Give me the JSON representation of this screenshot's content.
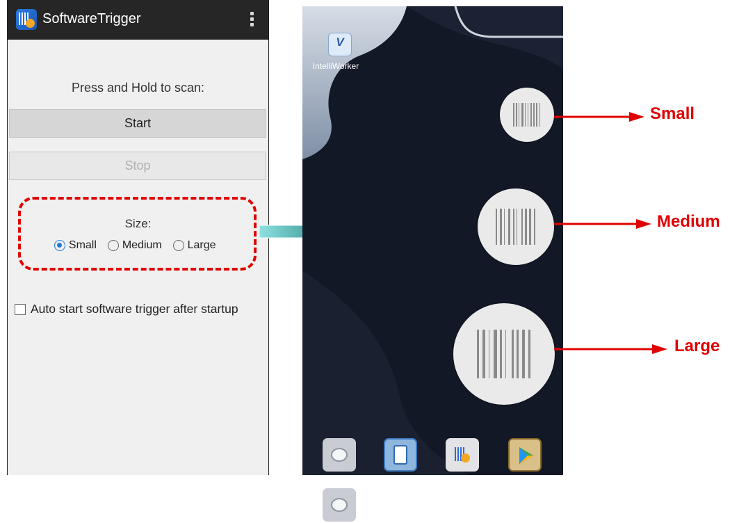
{
  "app": {
    "title": "SoftwareTrigger",
    "icon": "software-trigger-icon",
    "menu_icon": "overflow-menu-icon",
    "scan_prompt": "Press and Hold to scan:",
    "start_label": "Start",
    "stop_label": "Stop",
    "size_label": "Size:",
    "size_options": [
      {
        "label": "Small",
        "checked": true
      },
      {
        "label": "Medium",
        "checked": false
      },
      {
        "label": "Large",
        "checked": false
      }
    ],
    "auto_start_label": "Auto start software trigger after startup",
    "auto_start_checked": false
  },
  "home": {
    "app_label": "IntelliWorker",
    "app_icon": "intelliworker-icon",
    "floating_triggers": [
      "small",
      "medium",
      "large"
    ],
    "dock": [
      "keyboard-app-icon",
      "task-app-icon",
      "software-trigger-app-icon",
      "play-store-icon"
    ]
  },
  "annotations": {
    "small": "Small",
    "medium": "Medium",
    "large": "Large",
    "highlight_color": "#e00000",
    "connector_color": "#2a7c7c"
  }
}
